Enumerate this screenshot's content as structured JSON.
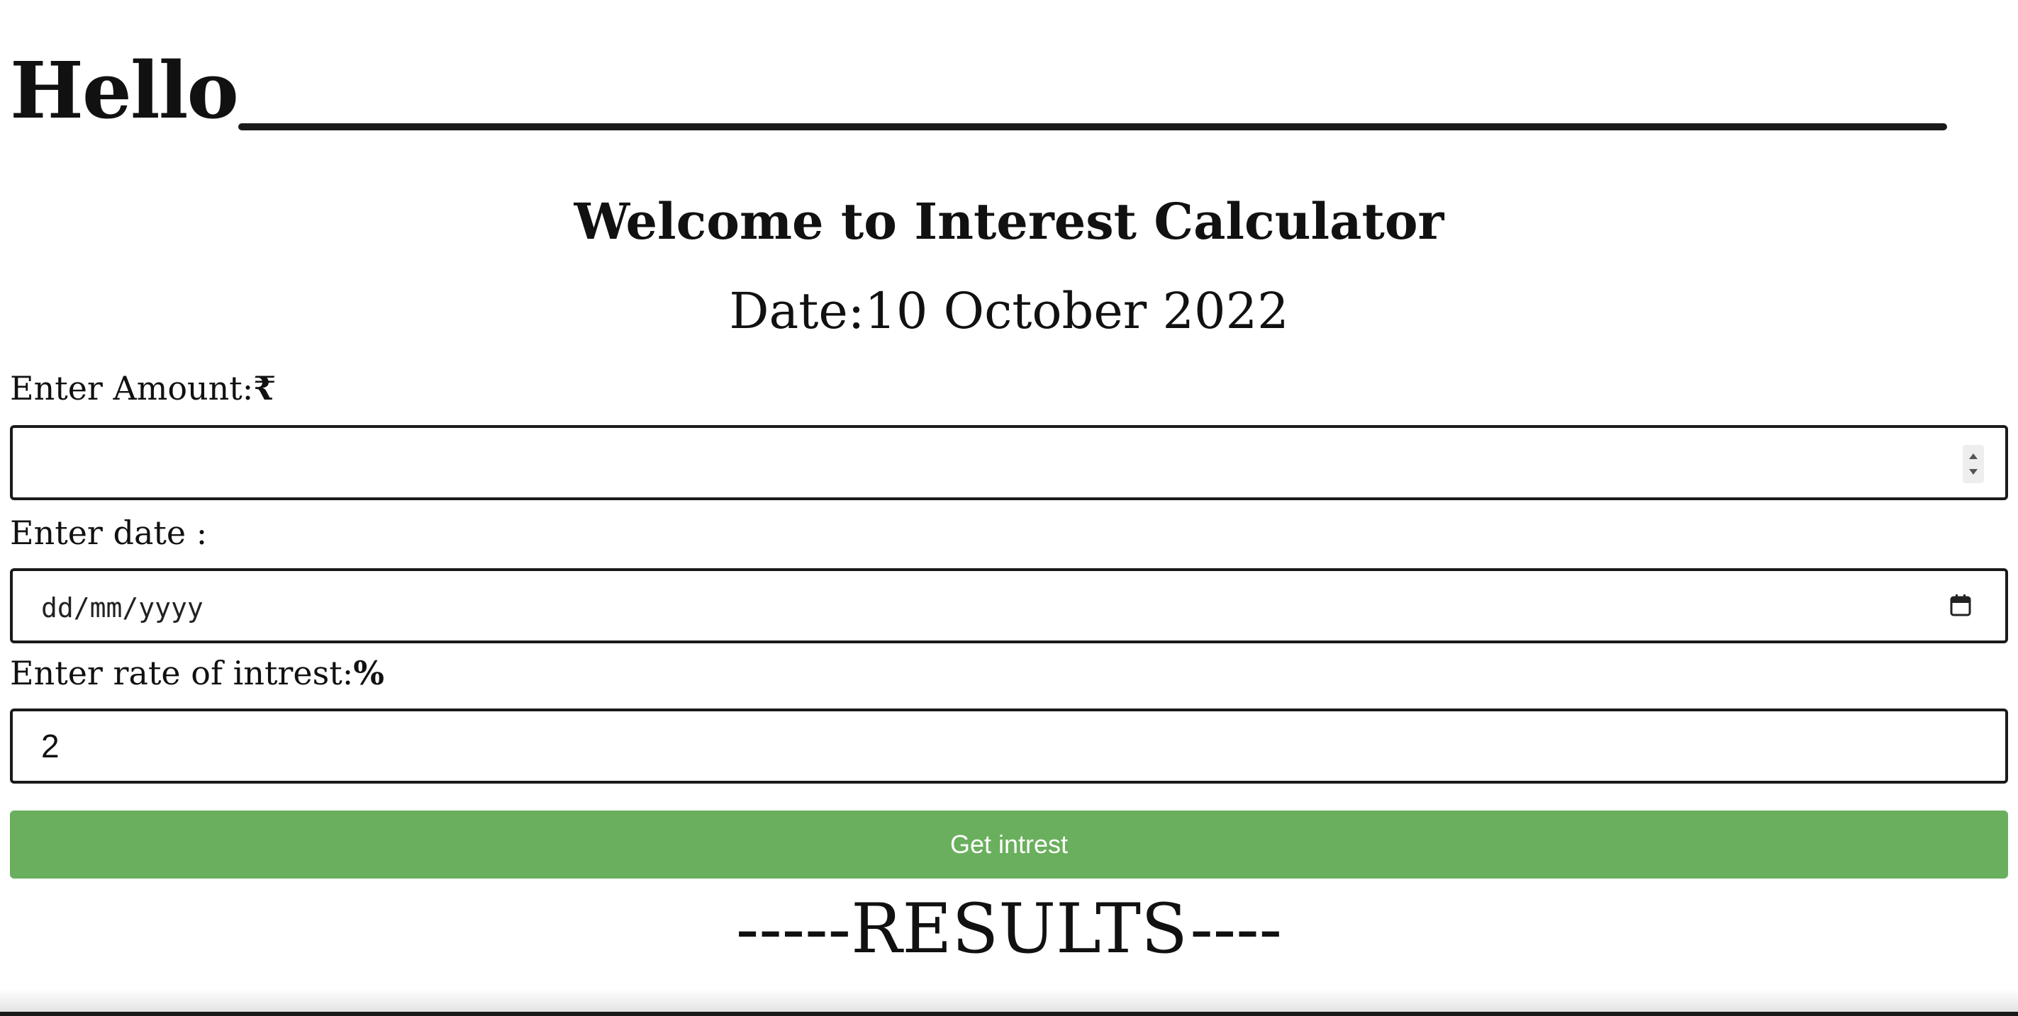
{
  "header": {
    "greeting": "Hello"
  },
  "main": {
    "title": "Welcome to Interest Calculator",
    "date_label": "Date:",
    "date_value": "10 October 2022"
  },
  "form": {
    "amount": {
      "label": "Enter Amount:",
      "symbol": "₹",
      "value": ""
    },
    "date": {
      "label": "Enter date :",
      "placeholder": "dd/mm/yyyy",
      "value": ""
    },
    "rate": {
      "label": "Enter rate of intrest:",
      "symbol": "%",
      "value": "2"
    },
    "submit_label": "Get intrest"
  },
  "results": {
    "heading": "-----RESULTS----"
  },
  "colors": {
    "button_bg": "#6aaf5d",
    "button_text": "#ffffff",
    "text": "#111111"
  },
  "icons": {
    "date_picker": "calendar-icon",
    "number_spinner": "spinner-icon"
  }
}
